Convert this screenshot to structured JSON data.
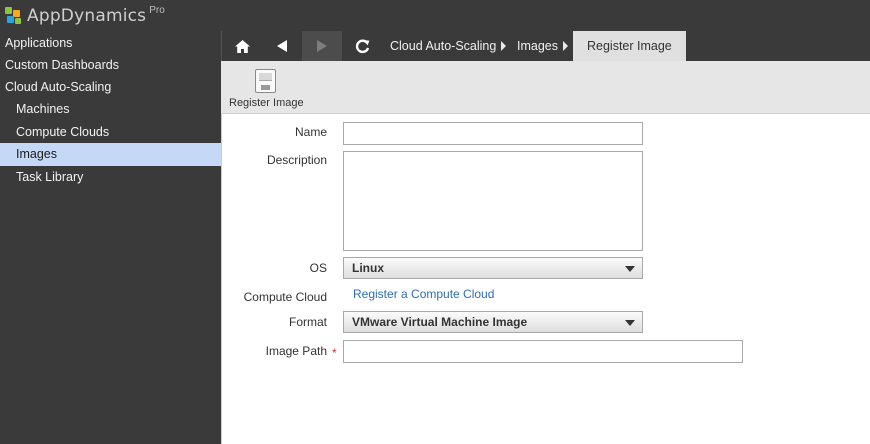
{
  "app": {
    "brand": "AppDynamics",
    "edition": "Pro",
    "logo_icon": "appdynamics-logo-icon"
  },
  "sidebar": {
    "items": [
      {
        "label": "Applications",
        "level": "top",
        "active": false
      },
      {
        "label": "Custom Dashboards",
        "level": "top",
        "active": false
      },
      {
        "label": "Cloud Auto-Scaling",
        "level": "top",
        "active": false
      },
      {
        "label": "Machines",
        "level": "sub",
        "active": false
      },
      {
        "label": "Compute Clouds",
        "level": "sub",
        "active": false
      },
      {
        "label": "Images",
        "level": "sub",
        "active": true
      },
      {
        "label": "Task Library",
        "level": "sub",
        "active": false
      }
    ]
  },
  "nav": {
    "icons": [
      "home-icon",
      "back-arrow-icon",
      "forward-arrow-icon",
      "refresh-icon"
    ],
    "breadcrumbs": [
      "Cloud Auto-Scaling",
      "Images"
    ],
    "current": "Register Image"
  },
  "toolbar": {
    "register_label": "Register Image",
    "register_icon": "save-disk-icon"
  },
  "form": {
    "name": {
      "label": "Name",
      "value": "",
      "placeholder": ""
    },
    "description": {
      "label": "Description",
      "value": ""
    },
    "os": {
      "label": "OS",
      "selected": "Linux"
    },
    "compute_cloud": {
      "label": "Compute Cloud",
      "link": "Register a Compute Cloud"
    },
    "format": {
      "label": "Format",
      "selected": "VMware Virtual Machine Image"
    },
    "image_path": {
      "label": "Image Path",
      "required_marker": "*",
      "value": ""
    }
  },
  "colors": {
    "chrome_dark": "#3a3a3a",
    "sidebar_active": "#c5d8f5",
    "toolbar_bg": "#e6e6e6",
    "link": "#2c6db5",
    "required": "#d0302e"
  }
}
